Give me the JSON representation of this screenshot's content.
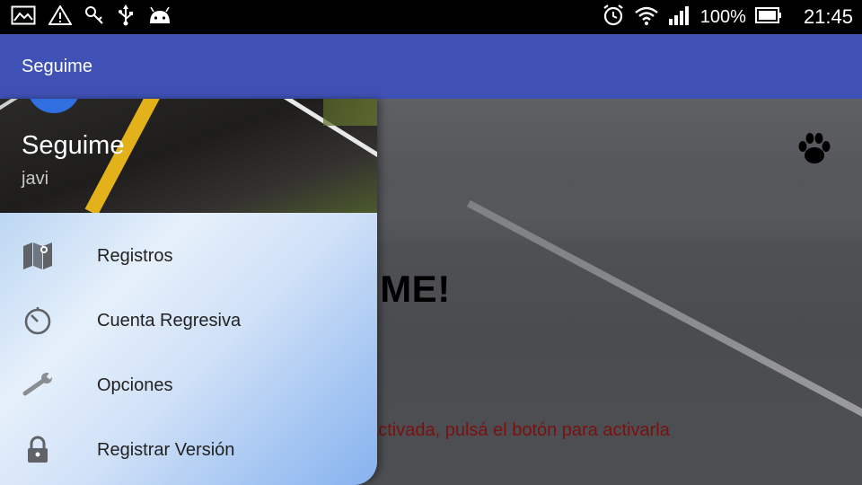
{
  "status_bar": {
    "battery_percent": "100%",
    "time": "21:45",
    "left_icons": [
      "image-icon",
      "warning-icon",
      "key-icon",
      "usb-icon",
      "android-icon"
    ],
    "right_icons": [
      "alarm-icon",
      "wifi-icon",
      "signal-icon",
      "battery-icon"
    ]
  },
  "app_bar": {
    "title": "Seguime"
  },
  "drawer": {
    "header": {
      "title": "Seguime",
      "subtitle": "javi"
    },
    "items": [
      {
        "label": "Registros",
        "icon": "map-icon"
      },
      {
        "label": "Cuenta Regresiva",
        "icon": "timer-icon"
      },
      {
        "label": "Opciones",
        "icon": "wrench-icon"
      },
      {
        "label": "Registrar Versión",
        "icon": "lock-icon"
      }
    ]
  },
  "main": {
    "heading": "SEGUIME!",
    "message": "La alarma está desactivada, pulsá el botón para activarla",
    "action_icon": "paw-icon"
  },
  "colors": {
    "app_bar": "#3f51b5",
    "message": "#7a1010"
  }
}
